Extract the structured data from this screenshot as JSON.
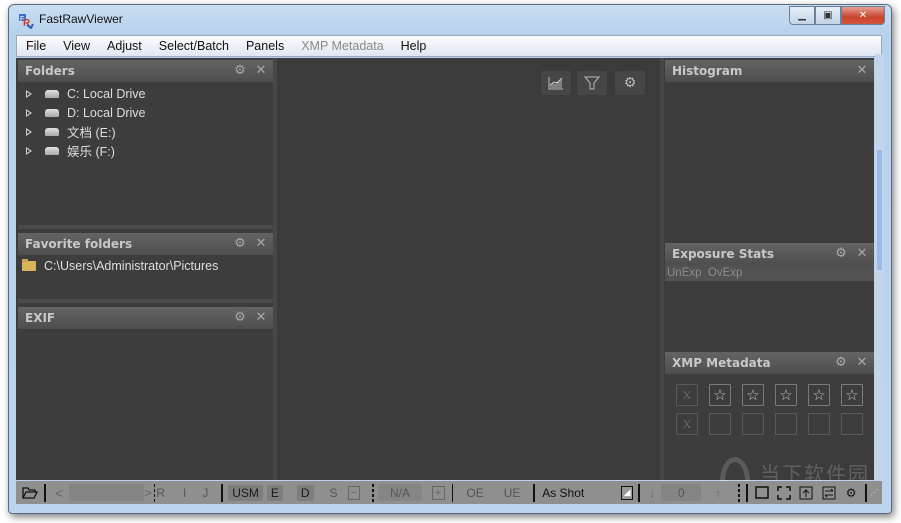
{
  "window": {
    "title": "FastRawViewer",
    "caption_buttons": {
      "minimize": "minimize",
      "maximize": "maximize",
      "close": "close"
    }
  },
  "menu": {
    "items": [
      {
        "label": "File",
        "enabled": true
      },
      {
        "label": "View",
        "enabled": true
      },
      {
        "label": "Adjust",
        "enabled": true
      },
      {
        "label": "Select/Batch",
        "enabled": true
      },
      {
        "label": "Panels",
        "enabled": true
      },
      {
        "label": "XMP Metadata",
        "enabled": false
      },
      {
        "label": "Help",
        "enabled": true
      }
    ]
  },
  "panels": {
    "folders": {
      "title": "Folders",
      "items": [
        {
          "label": "C: Local Drive",
          "icon": "drive-icon"
        },
        {
          "label": "D: Local Drive",
          "icon": "drive-icon"
        },
        {
          "label": "文档 (E:)",
          "icon": "drive-icon"
        },
        {
          "label": "娱乐 (F:)",
          "icon": "drive-icon"
        }
      ]
    },
    "favorites": {
      "title": "Favorite folders",
      "items": [
        {
          "label": "C:\\Users\\Administrator\\Pictures",
          "icon": "folder-icon"
        }
      ]
    },
    "exif": {
      "title": "EXIF"
    },
    "histogram": {
      "title": "Histogram"
    },
    "exposure": {
      "title": "Exposure Stats",
      "columns": "UnExp  OvExp"
    },
    "xmp": {
      "title": "XMP Metadata",
      "rating_row": [
        "X",
        "☆",
        "☆",
        "☆",
        "☆",
        "☆"
      ],
      "label_row": [
        "X",
        "",
        "",
        "",
        "",
        ""
      ]
    }
  },
  "viewer_toolbar": [
    "histogram-chart-icon",
    "filter-icon",
    "settings-gear-icon"
  ],
  "statusbar": {
    "open_folder": "open-folder-icon",
    "prev": "<",
    "next": ">",
    "r": "R",
    "i": "I",
    "j": "J",
    "usm": "USM",
    "e": "E",
    "d": "D",
    "s": "S",
    "minus": "−",
    "na": "N/A",
    "plus": "+",
    "oe": "OE",
    "ue": "UE",
    "white_balance": "As Shot",
    "exposure_value": "0"
  },
  "watermark": "当下软件园"
}
